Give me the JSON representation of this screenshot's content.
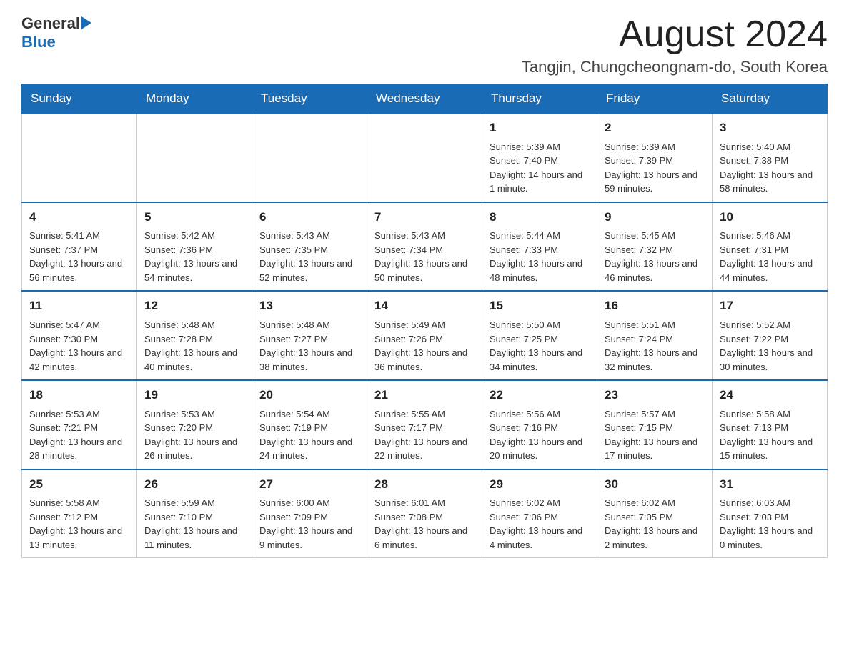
{
  "header": {
    "logo_general": "General",
    "logo_blue": "Blue",
    "month_title": "August 2024",
    "location": "Tangjin, Chungcheongnam-do, South Korea"
  },
  "days_of_week": [
    "Sunday",
    "Monday",
    "Tuesday",
    "Wednesday",
    "Thursday",
    "Friday",
    "Saturday"
  ],
  "weeks": [
    {
      "days": [
        {
          "number": "",
          "info": ""
        },
        {
          "number": "",
          "info": ""
        },
        {
          "number": "",
          "info": ""
        },
        {
          "number": "",
          "info": ""
        },
        {
          "number": "1",
          "info": "Sunrise: 5:39 AM\nSunset: 7:40 PM\nDaylight: 14 hours and 1 minute."
        },
        {
          "number": "2",
          "info": "Sunrise: 5:39 AM\nSunset: 7:39 PM\nDaylight: 13 hours and 59 minutes."
        },
        {
          "number": "3",
          "info": "Sunrise: 5:40 AM\nSunset: 7:38 PM\nDaylight: 13 hours and 58 minutes."
        }
      ]
    },
    {
      "days": [
        {
          "number": "4",
          "info": "Sunrise: 5:41 AM\nSunset: 7:37 PM\nDaylight: 13 hours and 56 minutes."
        },
        {
          "number": "5",
          "info": "Sunrise: 5:42 AM\nSunset: 7:36 PM\nDaylight: 13 hours and 54 minutes."
        },
        {
          "number": "6",
          "info": "Sunrise: 5:43 AM\nSunset: 7:35 PM\nDaylight: 13 hours and 52 minutes."
        },
        {
          "number": "7",
          "info": "Sunrise: 5:43 AM\nSunset: 7:34 PM\nDaylight: 13 hours and 50 minutes."
        },
        {
          "number": "8",
          "info": "Sunrise: 5:44 AM\nSunset: 7:33 PM\nDaylight: 13 hours and 48 minutes."
        },
        {
          "number": "9",
          "info": "Sunrise: 5:45 AM\nSunset: 7:32 PM\nDaylight: 13 hours and 46 minutes."
        },
        {
          "number": "10",
          "info": "Sunrise: 5:46 AM\nSunset: 7:31 PM\nDaylight: 13 hours and 44 minutes."
        }
      ]
    },
    {
      "days": [
        {
          "number": "11",
          "info": "Sunrise: 5:47 AM\nSunset: 7:30 PM\nDaylight: 13 hours and 42 minutes."
        },
        {
          "number": "12",
          "info": "Sunrise: 5:48 AM\nSunset: 7:28 PM\nDaylight: 13 hours and 40 minutes."
        },
        {
          "number": "13",
          "info": "Sunrise: 5:48 AM\nSunset: 7:27 PM\nDaylight: 13 hours and 38 minutes."
        },
        {
          "number": "14",
          "info": "Sunrise: 5:49 AM\nSunset: 7:26 PM\nDaylight: 13 hours and 36 minutes."
        },
        {
          "number": "15",
          "info": "Sunrise: 5:50 AM\nSunset: 7:25 PM\nDaylight: 13 hours and 34 minutes."
        },
        {
          "number": "16",
          "info": "Sunrise: 5:51 AM\nSunset: 7:24 PM\nDaylight: 13 hours and 32 minutes."
        },
        {
          "number": "17",
          "info": "Sunrise: 5:52 AM\nSunset: 7:22 PM\nDaylight: 13 hours and 30 minutes."
        }
      ]
    },
    {
      "days": [
        {
          "number": "18",
          "info": "Sunrise: 5:53 AM\nSunset: 7:21 PM\nDaylight: 13 hours and 28 minutes."
        },
        {
          "number": "19",
          "info": "Sunrise: 5:53 AM\nSunset: 7:20 PM\nDaylight: 13 hours and 26 minutes."
        },
        {
          "number": "20",
          "info": "Sunrise: 5:54 AM\nSunset: 7:19 PM\nDaylight: 13 hours and 24 minutes."
        },
        {
          "number": "21",
          "info": "Sunrise: 5:55 AM\nSunset: 7:17 PM\nDaylight: 13 hours and 22 minutes."
        },
        {
          "number": "22",
          "info": "Sunrise: 5:56 AM\nSunset: 7:16 PM\nDaylight: 13 hours and 20 minutes."
        },
        {
          "number": "23",
          "info": "Sunrise: 5:57 AM\nSunset: 7:15 PM\nDaylight: 13 hours and 17 minutes."
        },
        {
          "number": "24",
          "info": "Sunrise: 5:58 AM\nSunset: 7:13 PM\nDaylight: 13 hours and 15 minutes."
        }
      ]
    },
    {
      "days": [
        {
          "number": "25",
          "info": "Sunrise: 5:58 AM\nSunset: 7:12 PM\nDaylight: 13 hours and 13 minutes."
        },
        {
          "number": "26",
          "info": "Sunrise: 5:59 AM\nSunset: 7:10 PM\nDaylight: 13 hours and 11 minutes."
        },
        {
          "number": "27",
          "info": "Sunrise: 6:00 AM\nSunset: 7:09 PM\nDaylight: 13 hours and 9 minutes."
        },
        {
          "number": "28",
          "info": "Sunrise: 6:01 AM\nSunset: 7:08 PM\nDaylight: 13 hours and 6 minutes."
        },
        {
          "number": "29",
          "info": "Sunrise: 6:02 AM\nSunset: 7:06 PM\nDaylight: 13 hours and 4 minutes."
        },
        {
          "number": "30",
          "info": "Sunrise: 6:02 AM\nSunset: 7:05 PM\nDaylight: 13 hours and 2 minutes."
        },
        {
          "number": "31",
          "info": "Sunrise: 6:03 AM\nSunset: 7:03 PM\nDaylight: 13 hours and 0 minutes."
        }
      ]
    }
  ]
}
